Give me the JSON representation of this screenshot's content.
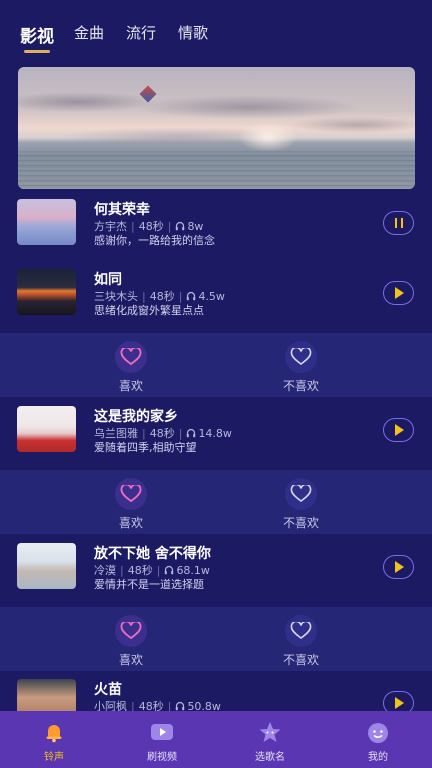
{
  "tabs": [
    {
      "label": "影视",
      "active": true
    },
    {
      "label": "金曲",
      "active": false
    },
    {
      "label": "流行",
      "active": false
    },
    {
      "label": "情歌",
      "active": false
    }
  ],
  "songs": [
    {
      "title": "何其荣幸",
      "artist": "方宇杰",
      "duration": "48秒",
      "plays": "8w",
      "desc": "感谢你，一路给我的信念",
      "state": "playing"
    },
    {
      "title": "如同",
      "artist": "三块木头",
      "duration": "48秒",
      "plays": "4.5w",
      "desc": "思绪化成窗外繁星点点",
      "state": "paused"
    },
    {
      "title": "这是我的家乡",
      "artist": "乌兰图雅",
      "duration": "48秒",
      "plays": "14.8w",
      "desc": "爱随着四季,相助守望",
      "state": "paused"
    },
    {
      "title": "放不下她 舍不得你",
      "artist": "冷漠",
      "duration": "48秒",
      "plays": "68.1w",
      "desc": "爱情并不是一道选择题",
      "state": "paused"
    },
    {
      "title": "火苗",
      "artist": "小阿枫",
      "duration": "48秒",
      "plays": "50.8w",
      "desc": "",
      "state": "paused"
    }
  ],
  "feedback": {
    "like": "喜欢",
    "dislike": "不喜欢"
  },
  "nav": [
    {
      "label": "铃声",
      "icon": "bell-icon",
      "active": true
    },
    {
      "label": "刷视频",
      "icon": "video-icon",
      "active": false
    },
    {
      "label": "选歌名",
      "icon": "star-icon",
      "active": false
    },
    {
      "label": "我的",
      "icon": "smile-icon",
      "active": false
    }
  ],
  "colors": {
    "background": "#1b1a63",
    "accent": "#f2c31b",
    "nav_bar": "#5a36b2",
    "tab_underline": "#d9b25a"
  }
}
